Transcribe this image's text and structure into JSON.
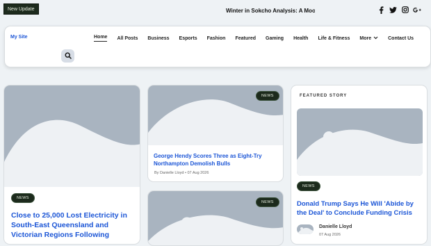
{
  "topbar": {
    "new_update_label": "New Update",
    "ticker_text": "Winter in Sokcho Analysis: A Moody"
  },
  "social_icons": [
    "facebook-icon",
    "twitter-icon",
    "instagram-icon",
    "google-plus-icon"
  ],
  "header": {
    "site_name": "My Site",
    "nav": [
      {
        "label": "Home",
        "active": true
      },
      {
        "label": "All Posts"
      },
      {
        "label": "Business"
      },
      {
        "label": "Esports"
      },
      {
        "label": "Fashion"
      },
      {
        "label": "Featured"
      },
      {
        "label": "Gaming"
      },
      {
        "label": "Health"
      },
      {
        "label": "Life & Fitness"
      },
      {
        "label": "More"
      },
      {
        "label": "Contact Us"
      }
    ],
    "search_icon": "search-icon"
  },
  "posts": [
    {
      "badge": "NEWS",
      "title": "Close to 25,000 Lost Electricity in South-East Queensland and Victorian Regions Following"
    },
    {
      "badge": "NEWS",
      "title": "George Hendy Scores Three as Eight-Try Northampton Demolish Bulls",
      "author": "By Danielle Lloyd",
      "date": "07 Aug 2026"
    },
    {
      "badge": "NEWS"
    }
  ],
  "featured": {
    "label": "FEATURED STORY",
    "badge": "NEWS",
    "title": "Donald Trump Says He Will 'Abide by the Deal' to Conclude Funding Crisis",
    "author": "Danielle Lloyd",
    "date": "07 Aug 2026"
  },
  "colors": {
    "accent": "#1b55d6",
    "badge_bg": "#1c2a1c",
    "placeholder_bg": "#a9b4c0",
    "placeholder_fg": "#eef1f4"
  }
}
